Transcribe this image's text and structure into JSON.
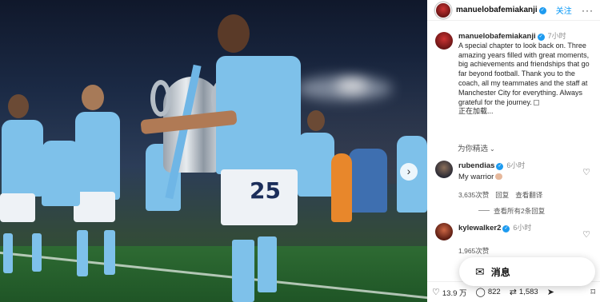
{
  "post_author": {
    "username": "manuelobafemiakanji",
    "follow_label": "关注",
    "more_label": "···"
  },
  "caption": {
    "username": "manuelobafemiakanji",
    "time": "7小时",
    "text": "A special chapter to look back on. Three amazing years filled with great moments, big achievements and friendships that go far beyond football. Thank you to the coach, all my teammates and the staff at Manchester City for everything. Always grateful for the journey.",
    "loading": "正在加载..."
  },
  "sort": {
    "label": "为你精选",
    "chevron": "⌄"
  },
  "comments": [
    {
      "username": "rubendias",
      "time": "6小时",
      "text": "My warrior",
      "likes": "3,635次赞",
      "reply_label": "回复",
      "translate_label": "查看翻译"
    },
    {
      "username": "kylewalker2",
      "time": "6小时",
      "likes": "1,965次赞"
    }
  ],
  "view_replies": "查看所有2条回复",
  "actions": {
    "likes": "13.9 万",
    "comments": "822",
    "reposts": "1,583"
  },
  "message_button": {
    "label": "消息"
  },
  "photo": {
    "jersey_number": "25"
  },
  "icons": {
    "heart": "heart-icon",
    "comment": "comment-icon",
    "repost": "repost-icon",
    "share": "share-icon",
    "bookmark": "bookmark-icon",
    "message": "message-icon",
    "next": "chevron-right-icon"
  },
  "colors": {
    "accent": "#0095f6",
    "verified": "#1d9bf0",
    "jersey": "#7ec1ea"
  }
}
